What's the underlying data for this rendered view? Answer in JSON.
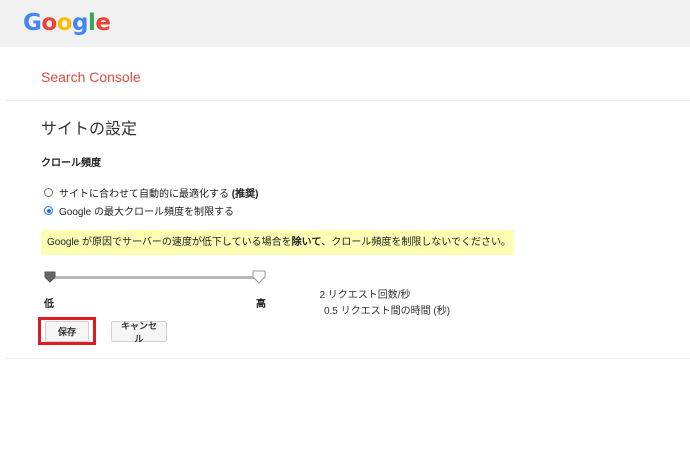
{
  "header": {
    "logo_letters": [
      {
        "ch": "G",
        "color": "#4285f4"
      },
      {
        "ch": "o",
        "color": "#ea4335"
      },
      {
        "ch": "o",
        "color": "#fbbc05"
      },
      {
        "ch": "g",
        "color": "#4285f4"
      },
      {
        "ch": "l",
        "color": "#34a853"
      },
      {
        "ch": "e",
        "color": "#ea4335"
      }
    ]
  },
  "product_name": "Search Console",
  "page_title": "サイトの設定",
  "crawl": {
    "section_label": "クロール頻度",
    "options": [
      {
        "label": "サイトに合わせて自動的に最適化する",
        "suffix": "(推奨)",
        "checked": false
      },
      {
        "label": "Google の最大クロール頻度を制限する",
        "suffix": "",
        "checked": true
      }
    ],
    "notice_prefix": "Google が原因でサーバーの速度が低下している場合を",
    "notice_bold": "除いて",
    "notice_suffix": "、クロール頻度を制限しないでください。",
    "slider": {
      "min_label": "低",
      "max_label": "高",
      "value_fraction": 1.0
    },
    "requests_per_second": "2 リクエスト回数/秒",
    "seconds_between": "0.5 リクエスト間の時間 (秒)"
  },
  "buttons": {
    "save": "保存",
    "cancel": "キャンセル"
  },
  "colors": {
    "topbar": "#f1f1f1",
    "product": "#dd4b39",
    "notice_bg": "#fdfdb4",
    "highlight": "#e01a22",
    "radio_active": "#1a73e8"
  }
}
